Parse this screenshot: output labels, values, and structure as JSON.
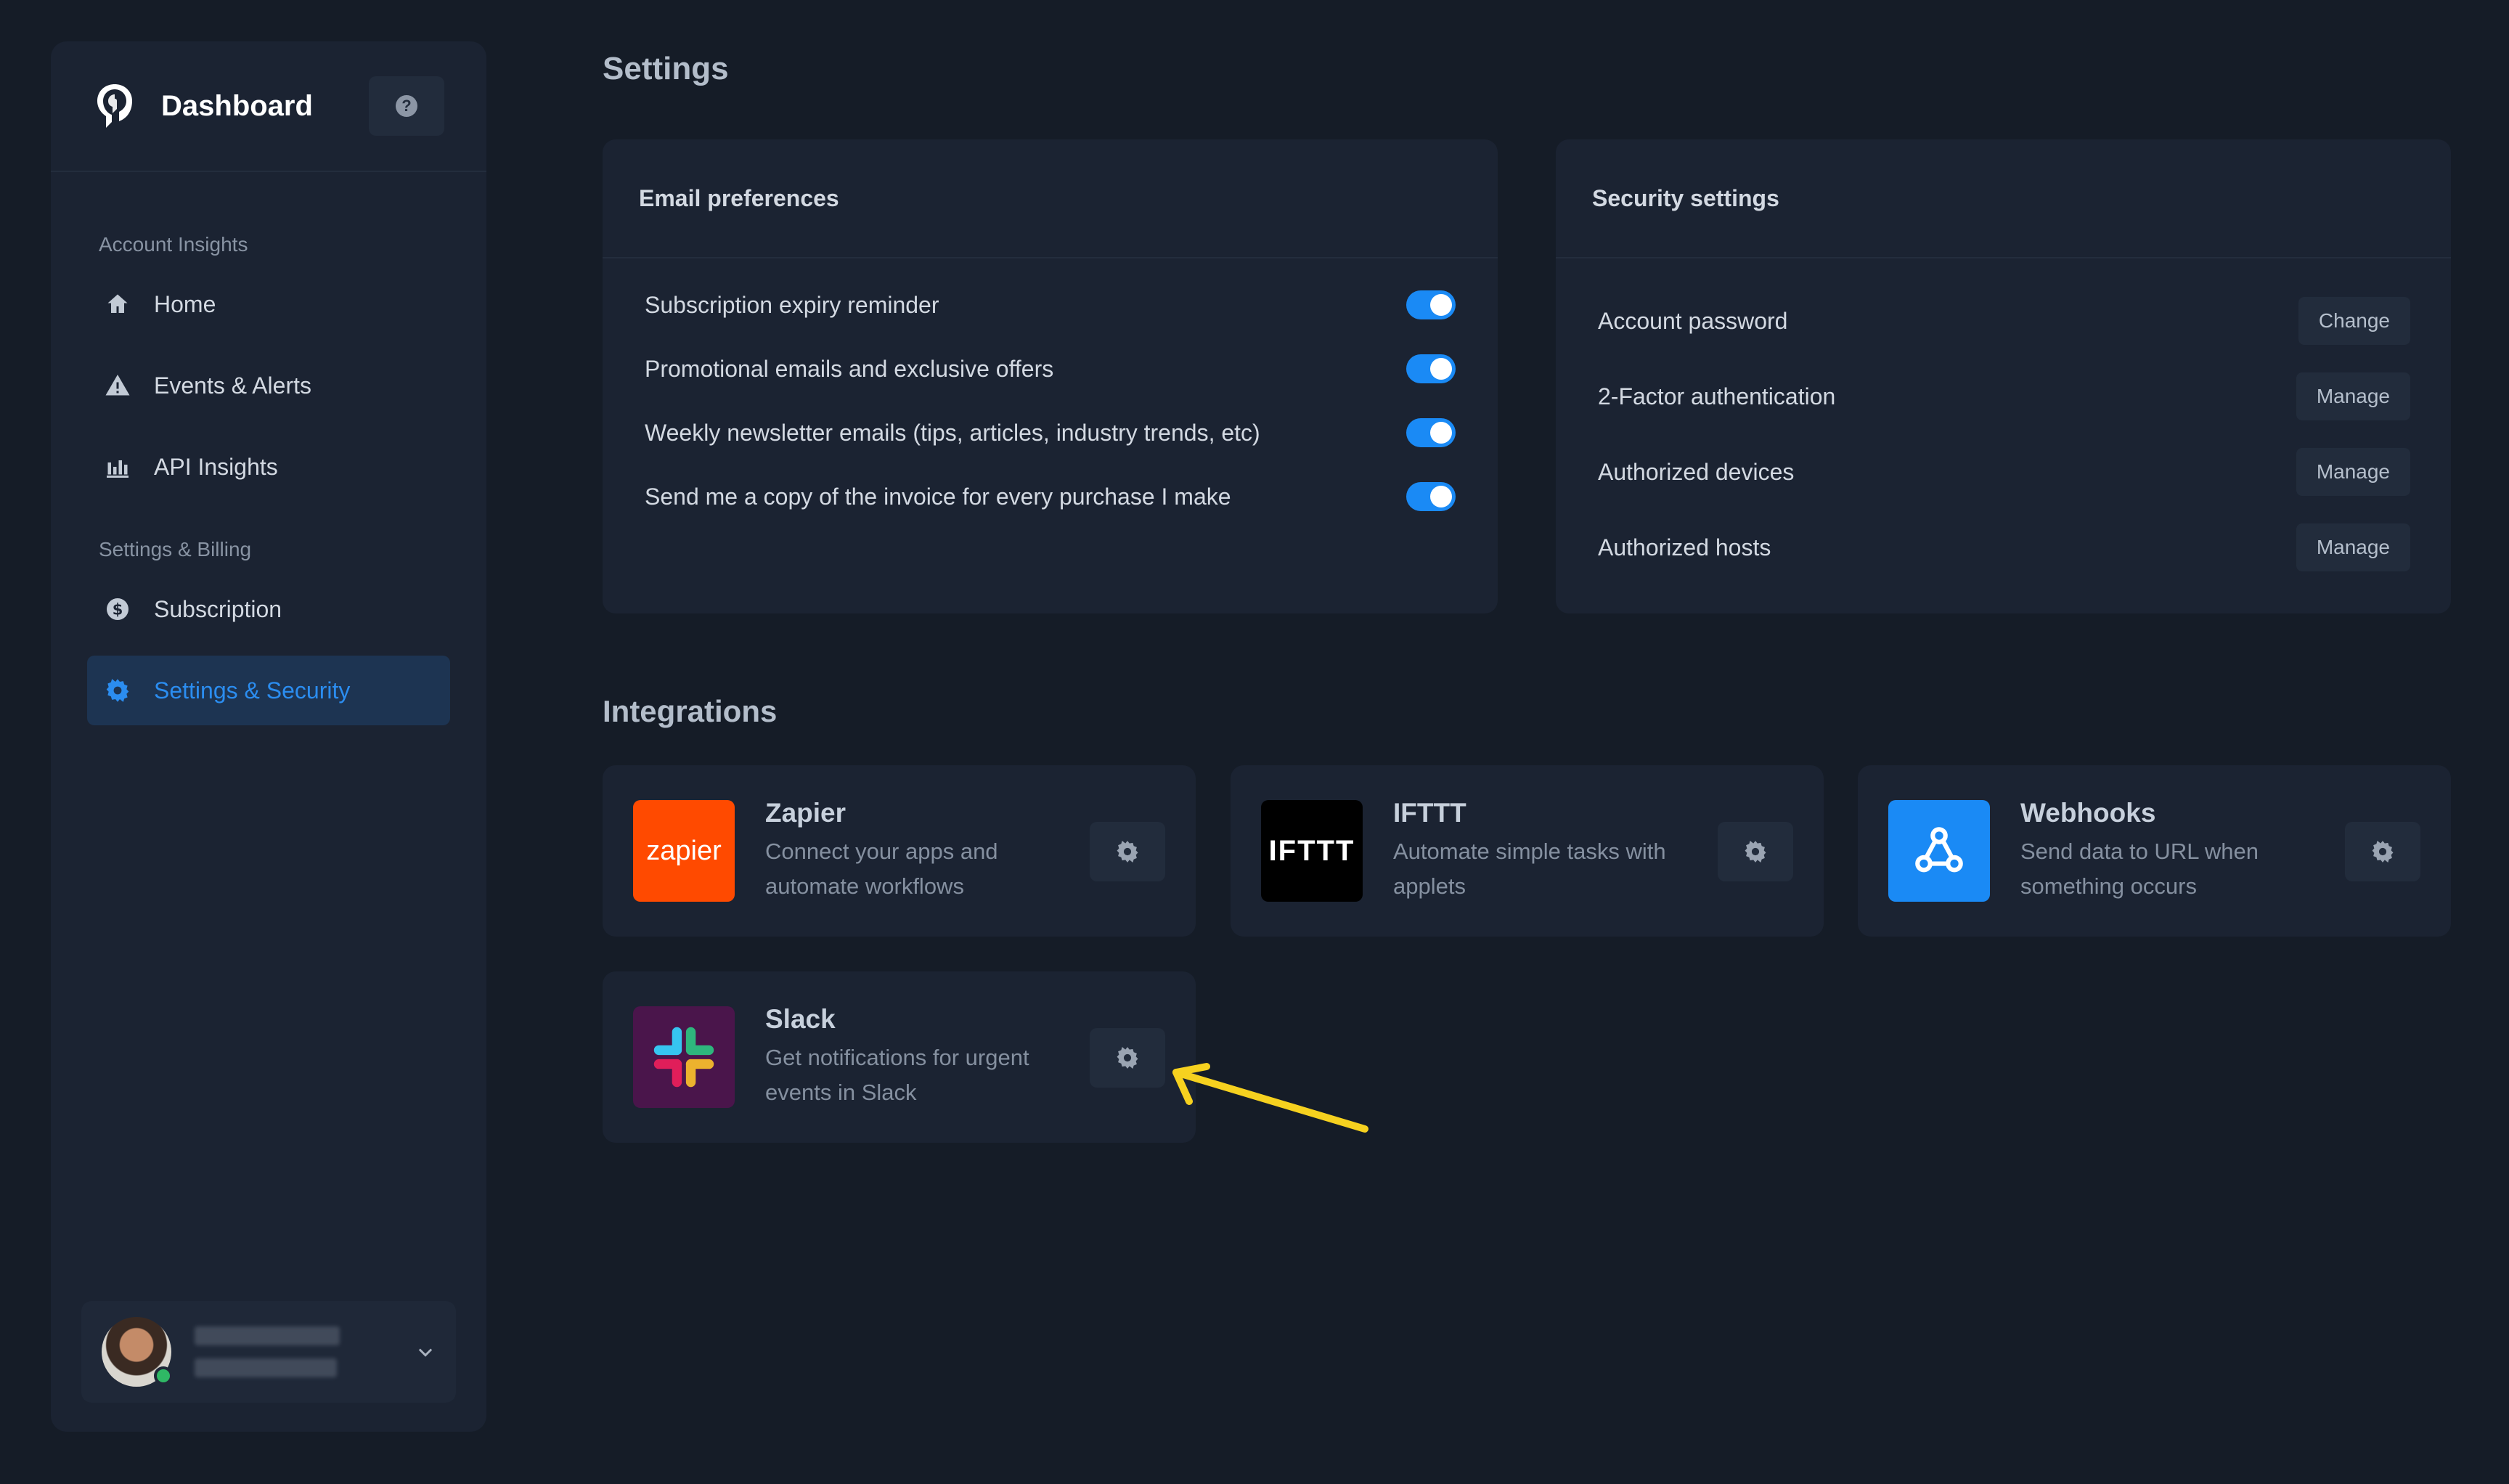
{
  "sidebar": {
    "title": "Dashboard",
    "help_label": "?",
    "sections": [
      {
        "label": "Account Insights"
      },
      {
        "label": "Settings & Billing"
      }
    ],
    "items": [
      {
        "label": "Home",
        "icon": "home-icon"
      },
      {
        "label": "Events & Alerts",
        "icon": "warning-icon"
      },
      {
        "label": "API Insights",
        "icon": "bar-chart-icon"
      },
      {
        "label": "Subscription",
        "icon": "dollar-icon"
      },
      {
        "label": "Settings & Security",
        "icon": "gear-icon",
        "active": true
      }
    ],
    "user": {
      "status": "online"
    }
  },
  "main": {
    "title": "Settings",
    "email": {
      "title": "Email preferences",
      "prefs": [
        {
          "label": "Subscription expiry reminder",
          "on": true
        },
        {
          "label": "Promotional emails and exclusive offers",
          "on": true
        },
        {
          "label": "Weekly newsletter emails (tips, articles, industry trends, etc)",
          "on": true
        },
        {
          "label": "Send me a copy of the invoice for every purchase I make",
          "on": true
        }
      ]
    },
    "security": {
      "title": "Security settings",
      "rows": [
        {
          "label": "Account password",
          "action": "Change"
        },
        {
          "label": "2-Factor authentication",
          "action": "Manage"
        },
        {
          "label": "Authorized devices",
          "action": "Manage"
        },
        {
          "label": "Authorized hosts",
          "action": "Manage"
        }
      ]
    },
    "integrations": {
      "title": "Integrations",
      "items": [
        {
          "name": "Zapier",
          "desc": "Connect your apps and automate workflows",
          "logo_text": "zapier",
          "color": "#ff4a00"
        },
        {
          "name": "IFTTT",
          "desc": "Automate simple tasks with applets",
          "logo_text": "IFTTT",
          "color": "#000000"
        },
        {
          "name": "Webhooks",
          "desc": "Send data to URL when something occurs",
          "color": "#1a8af5"
        },
        {
          "name": "Slack",
          "desc": "Get notifications for urgent events in Slack",
          "color": "#4a154b"
        }
      ]
    }
  },
  "colors": {
    "accent": "#1a8af5",
    "annotation_arrow": "#f6d11f"
  }
}
